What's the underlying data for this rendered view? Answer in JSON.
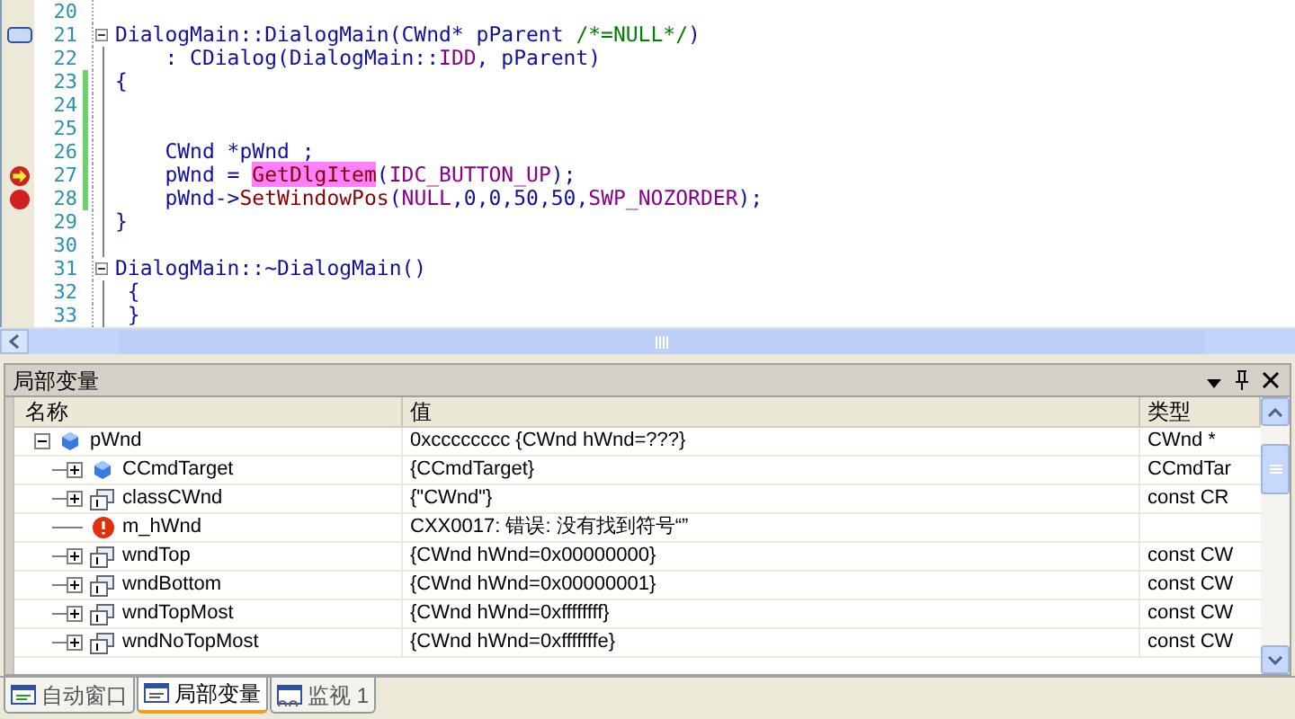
{
  "editor": {
    "lines": [
      {
        "number": "20",
        "bookmark": false,
        "breakpoint": false,
        "current": false,
        "collapsible": false
      },
      {
        "number": "21",
        "bookmark": true,
        "breakpoint": false,
        "current": false,
        "collapsible": true,
        "tokens": [
          {
            "kind": "plain",
            "t": "DialogMain::DialogMain(CWnd* pParent "
          },
          {
            "kind": "comment",
            "t": "/*=NULL*/"
          },
          {
            "kind": "plain",
            "t": ")"
          }
        ]
      },
      {
        "number": "22",
        "bookmark": false,
        "breakpoint": false,
        "current": false,
        "collapsible": false,
        "tokens": [
          {
            "kind": "plain",
            "t": "    : CDialog(DialogMain::"
          },
          {
            "kind": "macro",
            "t": "IDD"
          },
          {
            "kind": "plain",
            "t": ", pParent)"
          }
        ]
      },
      {
        "number": "23",
        "bookmark": false,
        "breakpoint": false,
        "current": false,
        "collapsible": false,
        "tokens": [
          {
            "kind": "plain",
            "t": "{"
          }
        ]
      },
      {
        "number": "24",
        "bookmark": false,
        "breakpoint": false,
        "current": false,
        "collapsible": false
      },
      {
        "number": "25",
        "bookmark": false,
        "breakpoint": false,
        "current": false,
        "collapsible": false
      },
      {
        "number": "26",
        "bookmark": false,
        "breakpoint": false,
        "current": false,
        "collapsible": false,
        "tokens": [
          {
            "kind": "plain",
            "t": "    CWnd *pWnd ;"
          }
        ]
      },
      {
        "number": "27",
        "bookmark": false,
        "breakpoint": true,
        "current": true,
        "collapsible": false,
        "tokens": [
          {
            "kind": "plain",
            "t": "    pWnd = "
          },
          {
            "kind": "highlight",
            "t": "GetDlgItem"
          },
          {
            "kind": "plain",
            "t": "("
          },
          {
            "kind": "macro",
            "t": "IDC_BUTTON_UP"
          },
          {
            "kind": "plain",
            "t": ");"
          }
        ]
      },
      {
        "number": "28",
        "bookmark": false,
        "breakpoint": true,
        "current": false,
        "collapsible": false,
        "tokens": [
          {
            "kind": "plain",
            "t": "    pWnd->"
          },
          {
            "kind": "func",
            "t": "SetWindowPos"
          },
          {
            "kind": "plain",
            "t": "("
          },
          {
            "kind": "macro",
            "t": "NULL"
          },
          {
            "kind": "plain",
            "t": ",0,0,50,50,"
          },
          {
            "kind": "macro",
            "t": "SWP_NOZORDER"
          },
          {
            "kind": "plain",
            "t": ");"
          }
        ]
      },
      {
        "number": "29",
        "bookmark": false,
        "breakpoint": false,
        "current": false,
        "collapsible": false,
        "tokens": [
          {
            "kind": "plain",
            "t": "}"
          }
        ]
      },
      {
        "number": "30",
        "bookmark": false,
        "breakpoint": false,
        "current": false,
        "collapsible": false
      },
      {
        "number": "31",
        "bookmark": false,
        "breakpoint": false,
        "current": false,
        "collapsible": true,
        "tokens": [
          {
            "kind": "plain",
            "t": "DialogMain::~DialogMain()"
          }
        ]
      },
      {
        "number": "32",
        "bookmark": false,
        "breakpoint": false,
        "current": false,
        "collapsible": false,
        "tokens": [
          {
            "kind": "plain",
            "t": " {"
          }
        ]
      },
      {
        "number": "33",
        "bookmark": false,
        "breakpoint": false,
        "current": false,
        "collapsible": false,
        "tokens": [
          {
            "kind": "plain",
            "t": " }"
          }
        ]
      }
    ]
  },
  "panel": {
    "title": "局部变量",
    "columns": [
      "名称",
      "值",
      "类型"
    ],
    "rows": [
      {
        "name": "pWnd",
        "value": "0xcccccccc {CWnd hWnd=???}",
        "type": "CWnd *",
        "kind": "member",
        "expanded": true,
        "children": [
          {
            "name": "CCmdTarget",
            "value": "{CCmdTarget}",
            "type": "CCmdTar",
            "kind": "member",
            "expanded": false
          },
          {
            "name": "classCWnd",
            "value": "{\"CWnd\"}",
            "type": "const CR",
            "kind": "static",
            "expanded": false
          },
          {
            "name": "m_hWnd",
            "value": "CXX0017: 错误: 没有找到符号“”",
            "kind": "error"
          },
          {
            "name": "wndTop",
            "value": "{CWnd hWnd=0x00000000}",
            "type": "const CW",
            "kind": "static",
            "expanded": false
          },
          {
            "name": "wndBottom",
            "value": "{CWnd hWnd=0x00000001}",
            "type": "const CW",
            "kind": "static",
            "expanded": false
          },
          {
            "name": "wndTopMost",
            "value": "{CWnd hWnd=0xffffffff}",
            "type": "const CW",
            "kind": "static",
            "expanded": false
          },
          {
            "name": "wndNoTopMost",
            "value": "{CWnd hWnd=0xfffffffe}",
            "type": "const CW",
            "kind": "static",
            "expanded": false
          }
        ]
      }
    ]
  },
  "tabs": [
    {
      "label": "自动窗口",
      "selected": false
    },
    {
      "label": "局部变量",
      "selected": true
    },
    {
      "label": "监视 1",
      "selected": false
    }
  ]
}
